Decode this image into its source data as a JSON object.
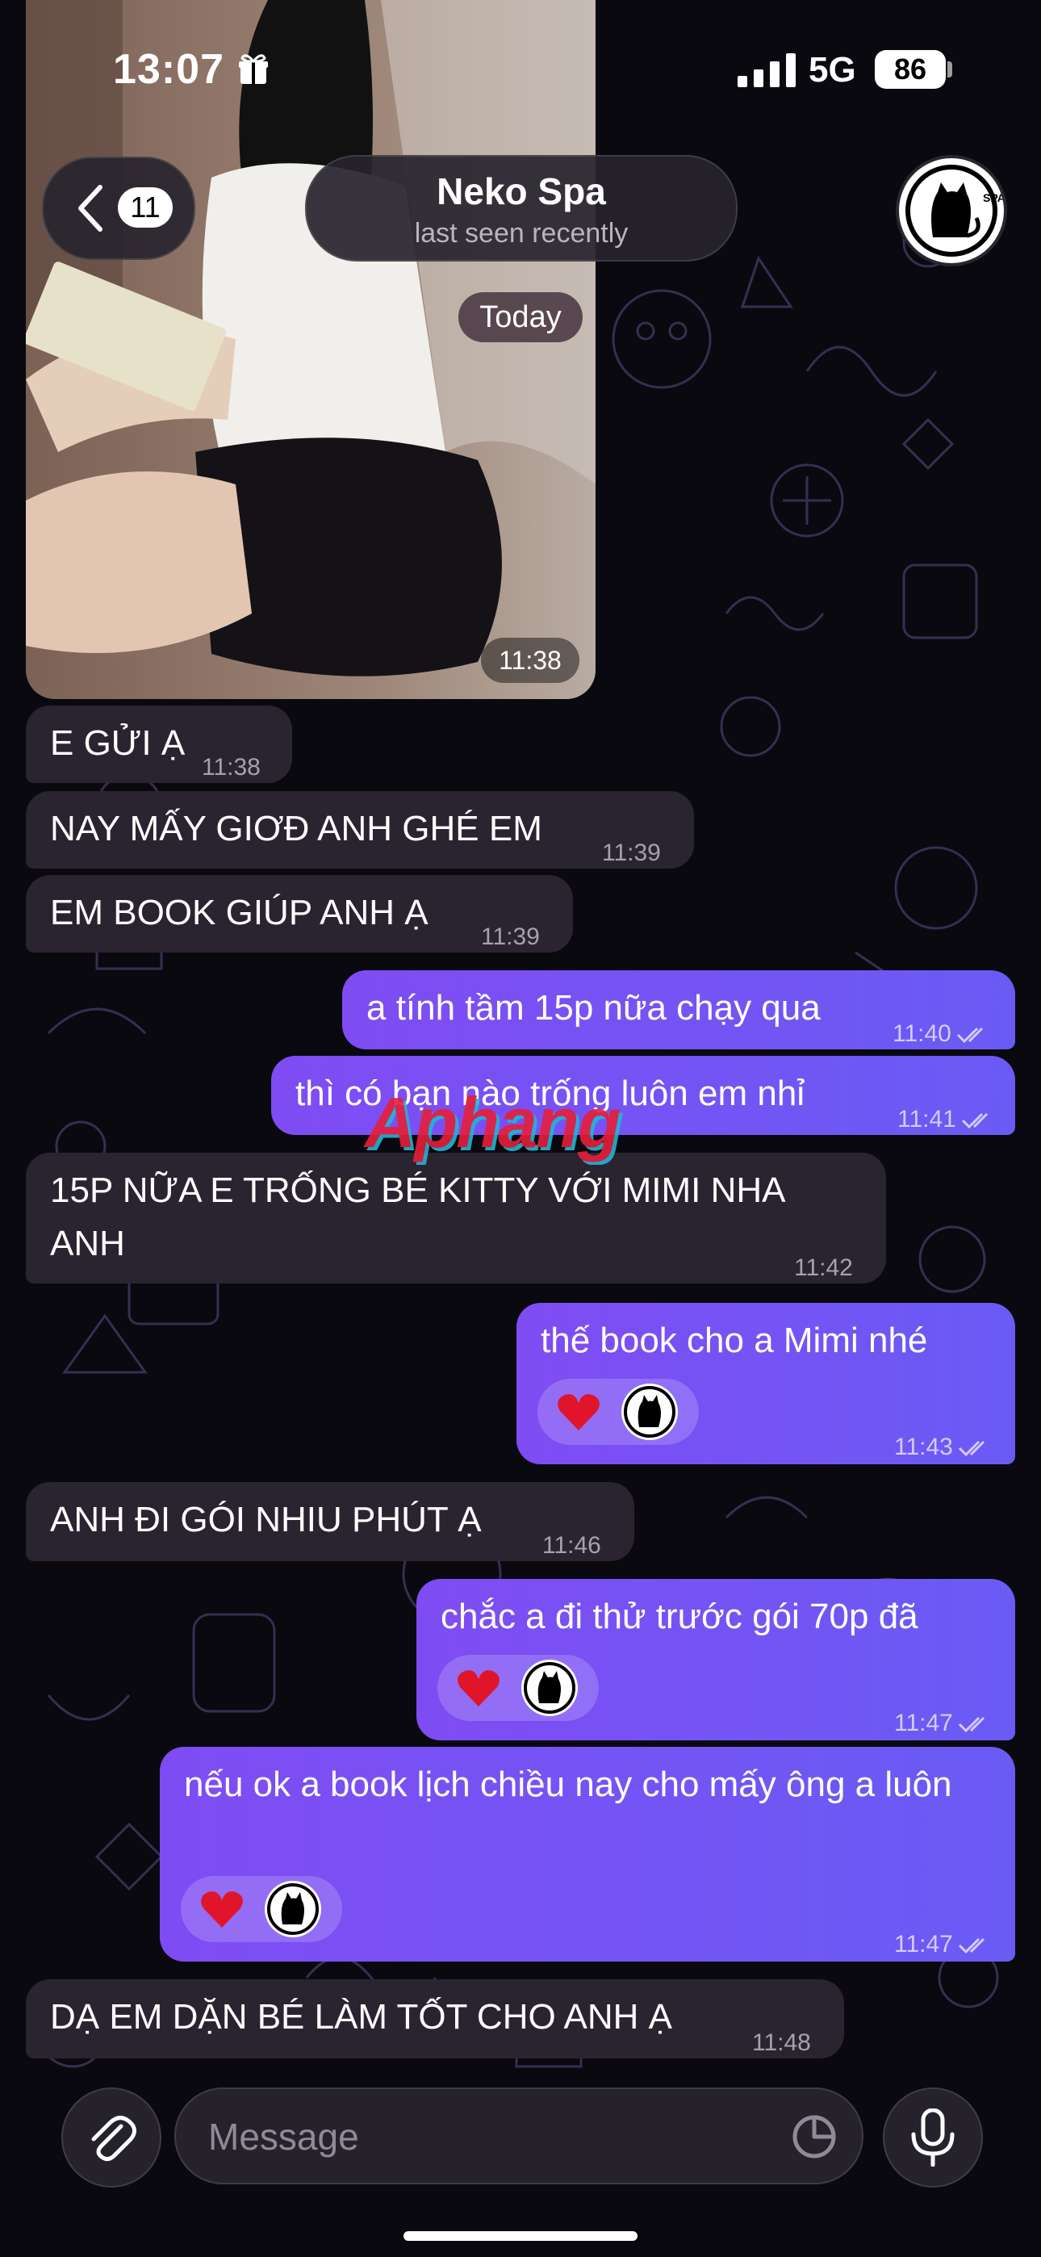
{
  "status_bar": {
    "time": "13:07",
    "network": "5G",
    "battery": "86"
  },
  "header": {
    "back_badge": "11",
    "title": "Neko Spa",
    "subtitle": "last seen recently",
    "avatar_label": "SPA"
  },
  "date_chip": "Today",
  "photo": {
    "time": "11:38"
  },
  "messages": [
    {
      "direction": "in",
      "text": "E GỬI Ạ",
      "time": "11:38"
    },
    {
      "direction": "in",
      "text": "NAY MẤY GIƠĐ ANH GHÉ EM",
      "time": "11:39"
    },
    {
      "direction": "in",
      "text": "EM BOOK GIÚP ANH Ạ",
      "time": "11:39"
    },
    {
      "direction": "out",
      "text": "a tính tầm 15p nữa chạy qua",
      "time": "11:40"
    },
    {
      "direction": "out",
      "text": "thì có bạn nào trống luôn em nhỉ",
      "time": "11:41"
    },
    {
      "direction": "in",
      "text": "15P NỮA E TRỐNG BÉ KITTY VỚI MIMI NHA ANH",
      "time": "11:42"
    },
    {
      "direction": "out",
      "text": "thế book cho a Mimi nhé",
      "time": "11:43",
      "reaction": "heart"
    },
    {
      "direction": "in",
      "text": "ANH ĐI GÓI NHIU PHÚT Ạ",
      "time": "11:46"
    },
    {
      "direction": "out",
      "text": "chắc a đi thử trước gói 70p đã",
      "time": "11:47",
      "reaction": "heart"
    },
    {
      "direction": "out",
      "text": "nếu ok a book lịch chiều nay cho mấy ông a luôn",
      "time": "11:47",
      "reaction": "heart"
    },
    {
      "direction": "in",
      "text": "DẠ EM DẶN BÉ LÀM TỐT CHO ANH Ạ",
      "time": "11:48"
    }
  ],
  "watermark": "Aphang",
  "input": {
    "placeholder": "Message"
  },
  "colors": {
    "incoming_bubble": "#2a2430",
    "outgoing_bubble": "#7a52f4",
    "background": "#0b0910"
  },
  "icons": [
    "gift-icon",
    "signal-icon",
    "chevron-left-icon",
    "cat-spa-logo",
    "heart-icon",
    "paperclip-icon",
    "sticker-icon",
    "microphone-icon",
    "double-check-icon"
  ]
}
